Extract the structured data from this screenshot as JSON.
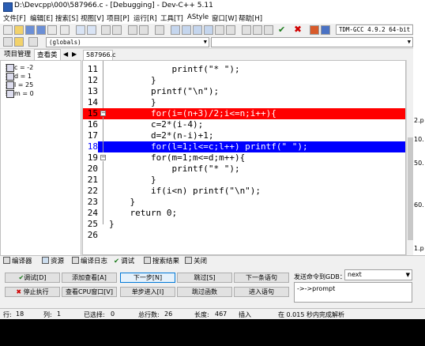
{
  "window": {
    "title": "D:\\Devcpp\\000\\587966.c - [Debugging] - Dev-C++ 5.11"
  },
  "menu": [
    "文件[F]",
    "编辑[E]",
    "搜索[S]",
    "视图[V]",
    "项目[P]",
    "运行[R]",
    "工具[T]",
    "AStyle",
    "窗口[W]",
    "帮助[H]"
  ],
  "toolbar": {
    "compiler": "TDM-GCC 4.9.2 64-bit",
    "globals": "(globals)"
  },
  "left_panel": {
    "tabs": [
      "项目管理",
      "查看类"
    ],
    "watch_items": [
      "c = -2",
      "d = 1",
      "l = 25",
      "m = 0"
    ]
  },
  "editor": {
    "file_tab": "587966.c",
    "lines": [
      {
        "num": "11",
        "text": "            printf(\"* \");"
      },
      {
        "num": "12",
        "text": "        }"
      },
      {
        "num": "13",
        "text": "        printf(\"\\n\");"
      },
      {
        "num": "14",
        "text": "        }"
      },
      {
        "num": "15",
        "text": "        for(i=(n+3)/2;i<=n;i++){"
      },
      {
        "num": "16",
        "text": "        c=2*(i-4);"
      },
      {
        "num": "17",
        "text": "        d=2*(n-i)+1;"
      },
      {
        "num": "18",
        "text": "        for(l=1;l<=c;l++) printf(\" \");"
      },
      {
        "num": "19",
        "text": "        for(m=1;m<=d;m++){"
      },
      {
        "num": "20",
        "text": "            printf(\"* \");"
      },
      {
        "num": "21",
        "text": "        }"
      },
      {
        "num": "22",
        "text": "        if(i<n) printf(\"\\n\");"
      },
      {
        "num": "23",
        "text": "    }"
      },
      {
        "num": "24",
        "text": "    return 0;"
      },
      {
        "num": "25",
        "text": "}"
      },
      {
        "num": "26",
        "text": ""
      }
    ]
  },
  "right_pane": [
    "2.p",
    "10.",
    "50.",
    "60.",
    "1.p"
  ],
  "bottom_tabs": [
    "编译器",
    "资源",
    "编译日志",
    "调试",
    "搜索结果",
    "关闭"
  ],
  "debug": {
    "row1": [
      "调试[D]",
      "添加查看[A]",
      "下一步[N]",
      "跳过[S]",
      "下一条语句"
    ],
    "row2": [
      "停止执行",
      "查看CPU窗口[V]",
      "单步进入[I]",
      "跳过函数",
      "进入语句"
    ],
    "gdb_label": "发送命令到GDB：",
    "gdb_command": "next",
    "gdb_output": "->->prompt"
  },
  "status": {
    "row_label": "行:",
    "row": "18",
    "col_label": "列:",
    "col": "1",
    "sel_label": "已选择:",
    "sel": "0",
    "total_label": "总行数:",
    "total": "26",
    "len_label": "长度:",
    "len": "467",
    "mode": "插入",
    "parse": "在 0.015 秒内完成解析"
  }
}
